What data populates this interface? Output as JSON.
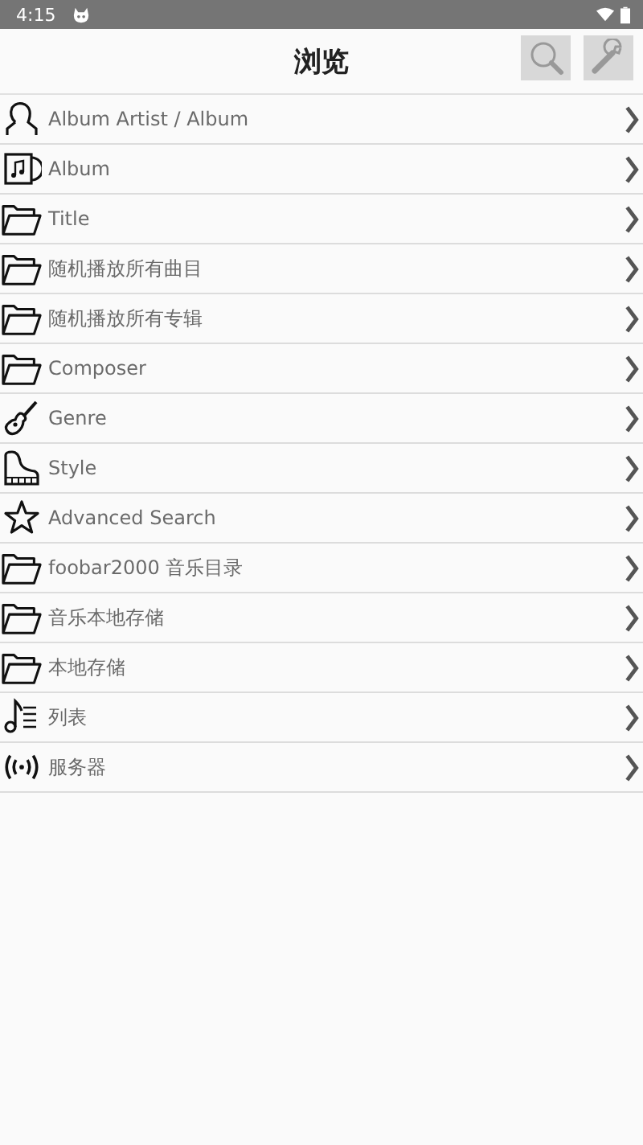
{
  "status_bar": {
    "time": "4:15"
  },
  "header": {
    "title": "浏览"
  },
  "items": [
    {
      "label": "Album Artist / Album",
      "kind": "person"
    },
    {
      "label": "Album",
      "kind": "album"
    },
    {
      "label": "Title",
      "kind": "folder"
    },
    {
      "label": "随机播放所有曲目",
      "kind": "folder"
    },
    {
      "label": "随机播放所有专辑",
      "kind": "folder"
    },
    {
      "label": "Composer",
      "kind": "folder"
    },
    {
      "label": "Genre",
      "kind": "guitar"
    },
    {
      "label": "Style",
      "kind": "piano"
    },
    {
      "label": "Advanced Search",
      "kind": "star"
    },
    {
      "label": "foobar2000 音乐目录",
      "kind": "folder"
    },
    {
      "label": "音乐本地存储",
      "kind": "folder"
    },
    {
      "label": "本地存储",
      "kind": "folder"
    },
    {
      "label": "列表",
      "kind": "playlist"
    },
    {
      "label": "服务器",
      "kind": "server"
    }
  ]
}
